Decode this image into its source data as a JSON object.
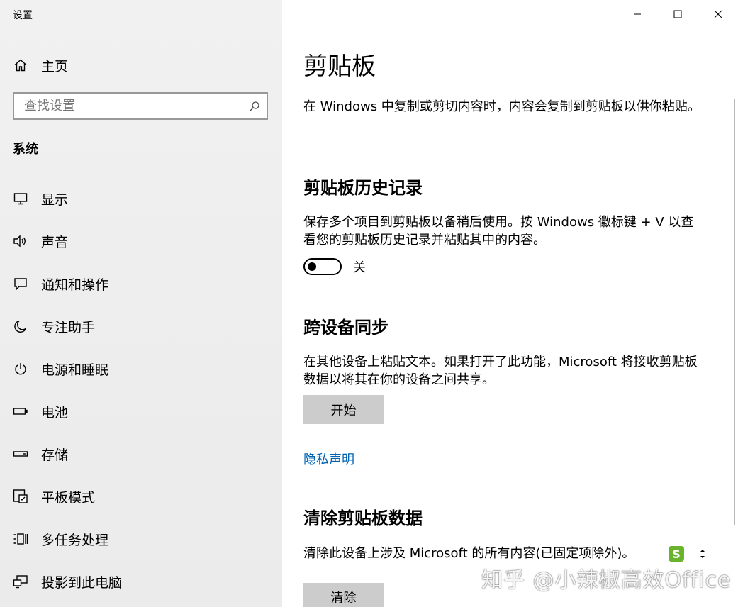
{
  "window": {
    "title": "设置"
  },
  "sidebar": {
    "home_label": "主页",
    "search_placeholder": "查找设置",
    "section_label": "系统",
    "items": [
      {
        "label": "显示",
        "icon": "monitor-icon"
      },
      {
        "label": "声音",
        "icon": "speaker-icon"
      },
      {
        "label": "通知和操作",
        "icon": "notification-icon"
      },
      {
        "label": "专注助手",
        "icon": "moon-icon"
      },
      {
        "label": "电源和睡眠",
        "icon": "power-icon"
      },
      {
        "label": "电池",
        "icon": "battery-icon"
      },
      {
        "label": "存储",
        "icon": "storage-icon"
      },
      {
        "label": "平板模式",
        "icon": "tablet-mode-icon"
      },
      {
        "label": "多任务处理",
        "icon": "multitasking-icon"
      },
      {
        "label": "投影到此电脑",
        "icon": "project-icon"
      }
    ]
  },
  "main": {
    "title": "剪贴板",
    "intro": "在 Windows 中复制或剪切内容时，内容会复制到剪贴板以供你粘贴。",
    "history": {
      "heading": "剪贴板历史记录",
      "description": "保存多个项目到剪贴板以备稍后使用。按 Windows 徽标键 + V 以查看您的剪贴板历史记录并粘贴其中的内容。",
      "toggle_state": "关"
    },
    "sync": {
      "heading": "跨设备同步",
      "description": "在其他设备上粘贴文本。如果打开了此功能，Microsoft 将接收剪贴板数据以将其在你的设备之间共享。",
      "button_label": "开始",
      "privacy_link": "隐私声明"
    },
    "clear": {
      "heading": "清除剪贴板数据",
      "description": "清除此设备上涉及 Microsoft 的所有内容(已固定项除外)。",
      "button_label": "清除"
    }
  },
  "overlay": {
    "watermark": "知乎 @小辣椒高效Office",
    "badge_letter": "S"
  },
  "colors": {
    "link": "#0063b1",
    "button_bg": "#cccccc",
    "sidebar_bg": "#f0f0f0"
  }
}
